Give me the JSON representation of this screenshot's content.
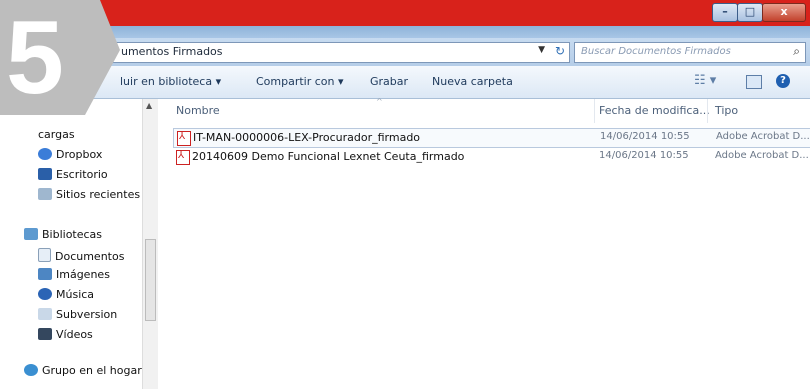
{
  "badge": "5",
  "window": {
    "controls": {
      "minimize": "–",
      "maximize": "□",
      "close": "x"
    }
  },
  "address": {
    "path": "umentos Firmados",
    "dropdown_icon": "chevron-down-icon",
    "refresh_icon": "refresh-icon"
  },
  "search": {
    "placeholder": "Buscar Documentos Firmados"
  },
  "toolbar": {
    "include": "luir en biblioteca ▾",
    "share": "Compartir con ▾",
    "burn": "Grabar",
    "new_folder": "Nueva carpeta",
    "help": "?"
  },
  "nav": {
    "items": [
      {
        "label": "cargas"
      },
      {
        "label": "Dropbox"
      },
      {
        "label": "Escritorio"
      },
      {
        "label": "Sitios recientes"
      }
    ],
    "libraries": {
      "label": "Bibliotecas",
      "items": [
        {
          "label": "Documentos"
        },
        {
          "label": "Imágenes"
        },
        {
          "label": "Música"
        },
        {
          "label": "Subversion"
        },
        {
          "label": "Vídeos"
        }
      ]
    },
    "homegroup": "Grupo en el hogar"
  },
  "columns": {
    "name": "Nombre",
    "date": "Fecha de modifica...",
    "type": "Tipo"
  },
  "files": [
    {
      "name": "IT-MAN-0000006-LEX-Procurador_firmado",
      "date": "14/06/2014 10:55",
      "type": "Adobe Acrobat D..."
    },
    {
      "name": "20140609 Demo Funcional Lexnet Ceuta_firmado",
      "date": "14/06/2014 10:55",
      "type": "Adobe Acrobat D..."
    }
  ],
  "colors": {
    "banner": "#d8221b",
    "badge": "#bdbdbd"
  }
}
